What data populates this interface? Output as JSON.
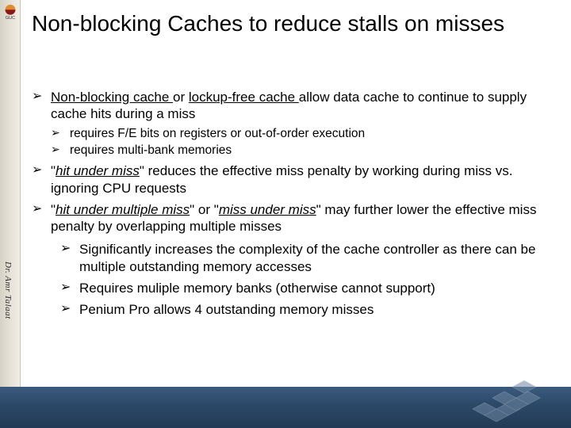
{
  "logo_label": "GUC",
  "author": "Dr. Amr Talaat",
  "title": "Non-blocking Caches to reduce stalls on misses",
  "b1": {
    "pre": "",
    "u1": "Non-blocking cache ",
    "mid1": "or  ",
    "u2": "lockup-free cache ",
    "post": "allow data cache to continue to supply cache hits during a miss",
    "sub1": "requires F/E bits on registers or out-of-order execution",
    "sub2": "requires multi-bank memories"
  },
  "b2": {
    "q1": "\"",
    "t1": "hit under miss",
    "q2": "\"  reduces the effective miss penalty by working during miss vs. ignoring CPU requests"
  },
  "b3": {
    "q1": "\"",
    "t1": "hit under multiple miss",
    "mid": "\"  or \"",
    "t2": "miss under miss",
    "q2": "\"  may further lower the effective miss penalty by overlapping multiple misses"
  },
  "b4": {
    "s1": "Significantly increases the complexity of the cache controller as there can be multiple outstanding memory accesses",
    "s2": "Requires muliple memory banks (otherwise cannot support)",
    "s3": "Penium Pro allows 4 outstanding memory misses"
  }
}
